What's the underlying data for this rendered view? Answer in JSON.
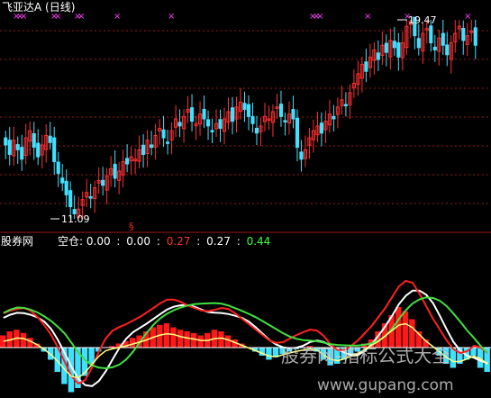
{
  "header": {
    "title": "飞亚达A (日线)",
    "marker_glyph": "×"
  },
  "price_panel": {
    "high_label": "19.47",
    "low_label": "11.09",
    "signal_glyph": "§",
    "colors": {
      "up": "#ff3030",
      "down": "#40e0ff",
      "marker": "#ff40ff",
      "grid": "#a01818",
      "text": "#ffffff"
    }
  },
  "indicator_panel": {
    "name": "股券网",
    "label": "空仓:",
    "values": [
      {
        "text": "0.00",
        "color": "#ffffff"
      },
      {
        "text": "0.00",
        "color": "#ffffff"
      },
      {
        "text": "0.27",
        "color": "#ff3030"
      },
      {
        "text": "0.27",
        "color": "#ffffff"
      },
      {
        "text": "0.44",
        "color": "#40ff40"
      }
    ],
    "separator": ":"
  },
  "watermark": {
    "line1": "股券网-指标公式大全",
    "line2": "www.gupang.com"
  },
  "chart_data": [
    {
      "type": "candlestick",
      "title": "飞亚达A (日线)",
      "annotations": [
        {
          "label": "19.47",
          "kind": "high"
        },
        {
          "label": "11.09",
          "kind": "low"
        }
      ],
      "close": [
        14.2,
        13.8,
        14.4,
        14.0,
        13.6,
        14.5,
        14.8,
        14.1,
        13.7,
        14.2,
        14.6,
        14.3,
        13.5,
        13.0,
        12.6,
        12.1,
        11.6,
        11.3,
        11.5,
        11.9,
        12.2,
        12.0,
        12.4,
        12.7,
        12.5,
        12.9,
        13.2,
        12.8,
        13.1,
        13.5,
        13.4,
        13.7,
        13.6,
        14.0,
        13.8,
        14.4,
        14.1,
        14.6,
        14.9,
        14.5,
        14.3,
        14.8,
        15.3,
        15.0,
        15.4,
        15.7,
        15.2,
        15.1,
        15.5,
        15.3,
        15.0,
        14.8,
        15.1,
        14.9,
        15.3,
        15.6,
        15.2,
        15.8,
        16.0,
        15.7,
        15.4,
        15.1,
        14.7,
        15.0,
        15.4,
        15.3,
        15.6,
        15.8,
        15.4,
        15.2,
        15.5,
        15.3,
        14.1,
        13.6,
        14.0,
        14.5,
        14.8,
        15.0,
        14.7,
        15.2,
        15.5,
        15.3,
        15.8,
        16.1,
        15.9,
        16.4,
        16.8,
        17.2,
        17.6,
        17.3,
        17.9,
        18.2,
        17.8,
        18.4,
        18.1,
        18.6,
        18.3,
        17.9,
        18.5,
        19.2,
        19.4,
        18.8,
        18.3,
        18.9,
        19.1,
        18.5,
        18.2,
        18.7,
        18.4,
        18.0,
        18.5,
        18.9,
        19.2,
        18.6,
        18.8,
        19.0,
        18.4
      ],
      "high": 19.47,
      "low": 11.09
    },
    {
      "type": "bar",
      "title": "股券网",
      "series": [
        {
          "name": "空仓",
          "values": [
            0.15,
            0.2,
            0.22,
            0.18,
            0.12,
            0.05,
            -0.05,
            -0.15,
            -0.3,
            -0.45,
            -0.55,
            -0.5,
            -0.35,
            -0.2,
            -0.05,
            0.0,
            0.02,
            0.05,
            0.08,
            0.12,
            0.15,
            0.2,
            0.25,
            0.28,
            0.3,
            0.25,
            0.22,
            0.2,
            0.18,
            0.15,
            0.18,
            0.22,
            0.2,
            0.15,
            0.1,
            0.05,
            0.0,
            -0.05,
            -0.1,
            -0.15,
            -0.12,
            -0.08,
            -0.05,
            -0.02,
            0.0,
            0.02,
            -0.05,
            -0.15,
            -0.22,
            -0.2,
            -0.15,
            -0.1,
            -0.05,
            0.05,
            0.1,
            0.2,
            0.3,
            0.4,
            0.5,
            0.45,
            0.35,
            0.2,
            0.1,
            0.0,
            -0.1,
            -0.2,
            -0.25,
            -0.2,
            -0.15,
            -0.1,
            -0.25,
            -0.3
          ]
        }
      ]
    }
  ]
}
